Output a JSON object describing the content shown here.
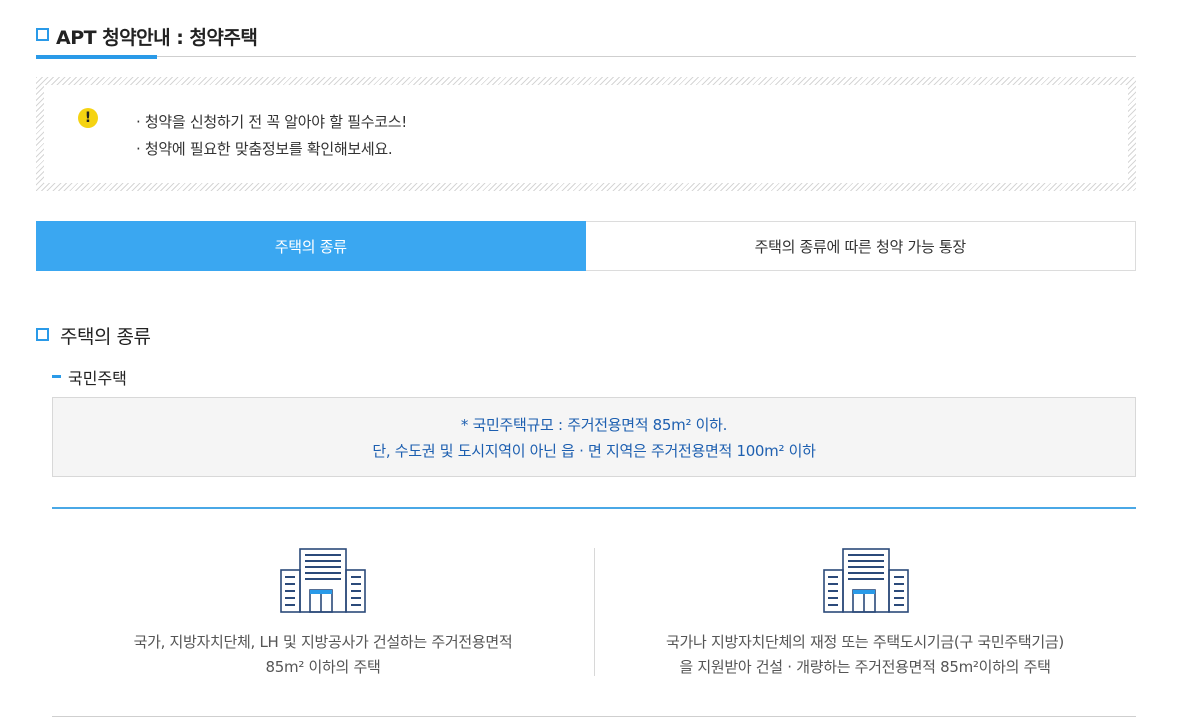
{
  "header": {
    "title": "APT 청약안내 : 청약주택"
  },
  "notice": {
    "icon": "warning-icon",
    "lines": [
      "· 청약을 신청하기 전 꼭 알아야 할 필수코스!",
      "· 청약에 필요한 맞춤정보를 확인해보세요."
    ]
  },
  "tabs": [
    {
      "label": "주택의 종류",
      "active": true
    },
    {
      "label": "주택의 종류에 따른 청약 가능 통장",
      "active": false
    }
  ],
  "section": {
    "title": "주택의 종류",
    "subtitle": "국민주택",
    "info": {
      "line1": "* 국민주택규모 : 주거전용면적 85m² 이하.",
      "line2": "단, 수도권 및 도시지역이 아닌 읍 · 면 지역은 주거전용면적 100m² 이하"
    },
    "cards": [
      {
        "icon": "building-icon",
        "line1": "국가, 지방자치단체, LH 및 지방공사가 건설하는 주거전용면적",
        "line2": "85m² 이하의 주택"
      },
      {
        "icon": "building-icon",
        "line1": "국가나 지방자치단체의 재정 또는 주택도시기금(구 국민주택기금)",
        "line2": "을 지원받아 건설 · 개량하는 주거전용면적 85m²이하의 주택"
      }
    ]
  },
  "colors": {
    "accent": "#2a9ae8",
    "tab_active": "#3aa7f1",
    "info_text": "#1d5fb0",
    "warning": "#f5d312"
  }
}
